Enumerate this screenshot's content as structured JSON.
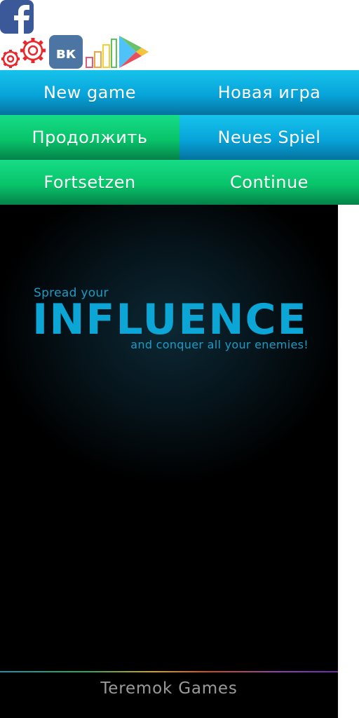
{
  "social": {
    "icons": [
      "facebook-icon",
      "settings-icon",
      "vk-icon",
      "stats-icon",
      "google-play-icon"
    ],
    "colors": {
      "facebook": "#3b5998",
      "vk": "#4c75a3",
      "gear": "#e8262b"
    },
    "vk_label": "вк"
  },
  "menu": {
    "new_game_en": "New game",
    "new_game_ru": "Новая игра",
    "continue_ru": "Продолжить",
    "new_game_de": "Neues Spiel",
    "continue_de": "Fortsetzen",
    "continue_en": "Continue",
    "colors": {
      "blue": "#07a4da",
      "green": "#08c46a"
    }
  },
  "game": {
    "tagline_top": "Spread your",
    "title": "INFLUENCE",
    "tagline_bottom": "and conquer all your enemies!",
    "accent": "#0ca6d6"
  },
  "footer": {
    "developer": "Teremok Games"
  }
}
